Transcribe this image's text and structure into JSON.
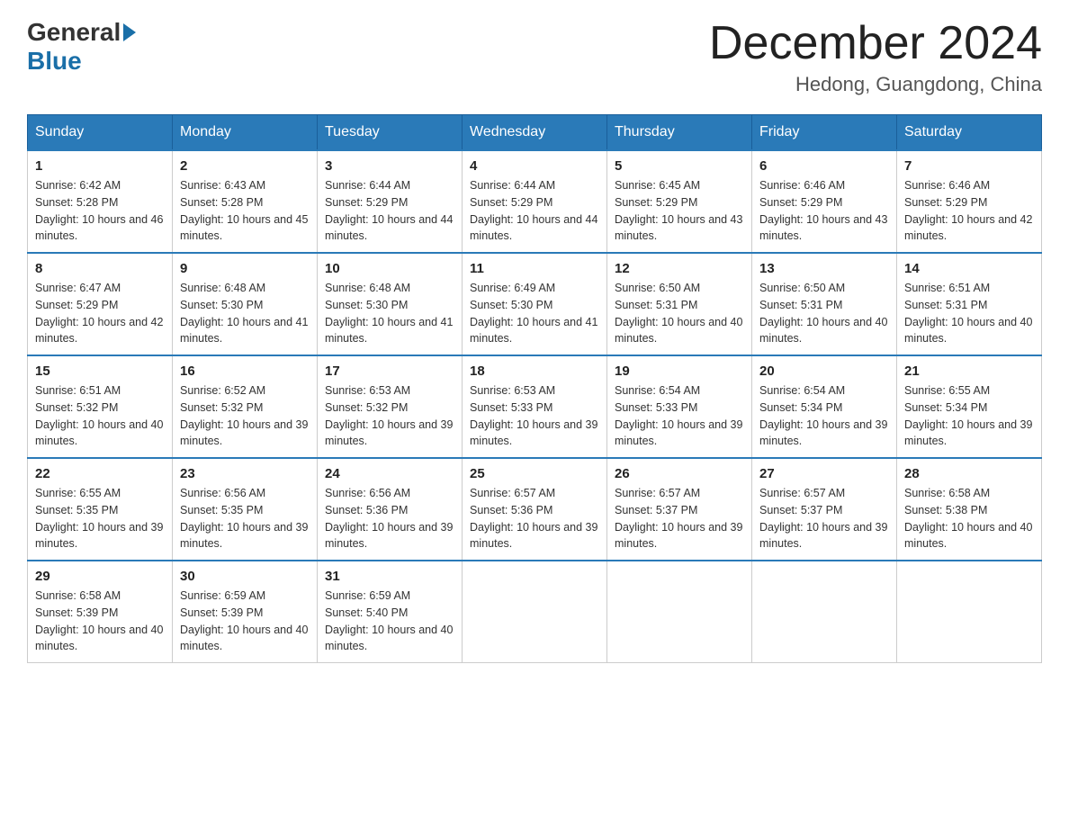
{
  "logo": {
    "general": "General",
    "blue": "Blue"
  },
  "title": "December 2024",
  "location": "Hedong, Guangdong, China",
  "days_of_week": [
    "Sunday",
    "Monday",
    "Tuesday",
    "Wednesday",
    "Thursday",
    "Friday",
    "Saturday"
  ],
  "weeks": [
    [
      {
        "day": "1",
        "sunrise": "6:42 AM",
        "sunset": "5:28 PM",
        "daylight": "10 hours and 46 minutes."
      },
      {
        "day": "2",
        "sunrise": "6:43 AM",
        "sunset": "5:28 PM",
        "daylight": "10 hours and 45 minutes."
      },
      {
        "day": "3",
        "sunrise": "6:44 AM",
        "sunset": "5:29 PM",
        "daylight": "10 hours and 44 minutes."
      },
      {
        "day": "4",
        "sunrise": "6:44 AM",
        "sunset": "5:29 PM",
        "daylight": "10 hours and 44 minutes."
      },
      {
        "day": "5",
        "sunrise": "6:45 AM",
        "sunset": "5:29 PM",
        "daylight": "10 hours and 43 minutes."
      },
      {
        "day": "6",
        "sunrise": "6:46 AM",
        "sunset": "5:29 PM",
        "daylight": "10 hours and 43 minutes."
      },
      {
        "day": "7",
        "sunrise": "6:46 AM",
        "sunset": "5:29 PM",
        "daylight": "10 hours and 42 minutes."
      }
    ],
    [
      {
        "day": "8",
        "sunrise": "6:47 AM",
        "sunset": "5:29 PM",
        "daylight": "10 hours and 42 minutes."
      },
      {
        "day": "9",
        "sunrise": "6:48 AM",
        "sunset": "5:30 PM",
        "daylight": "10 hours and 41 minutes."
      },
      {
        "day": "10",
        "sunrise": "6:48 AM",
        "sunset": "5:30 PM",
        "daylight": "10 hours and 41 minutes."
      },
      {
        "day": "11",
        "sunrise": "6:49 AM",
        "sunset": "5:30 PM",
        "daylight": "10 hours and 41 minutes."
      },
      {
        "day": "12",
        "sunrise": "6:50 AM",
        "sunset": "5:31 PM",
        "daylight": "10 hours and 40 minutes."
      },
      {
        "day": "13",
        "sunrise": "6:50 AM",
        "sunset": "5:31 PM",
        "daylight": "10 hours and 40 minutes."
      },
      {
        "day": "14",
        "sunrise": "6:51 AM",
        "sunset": "5:31 PM",
        "daylight": "10 hours and 40 minutes."
      }
    ],
    [
      {
        "day": "15",
        "sunrise": "6:51 AM",
        "sunset": "5:32 PM",
        "daylight": "10 hours and 40 minutes."
      },
      {
        "day": "16",
        "sunrise": "6:52 AM",
        "sunset": "5:32 PM",
        "daylight": "10 hours and 39 minutes."
      },
      {
        "day": "17",
        "sunrise": "6:53 AM",
        "sunset": "5:32 PM",
        "daylight": "10 hours and 39 minutes."
      },
      {
        "day": "18",
        "sunrise": "6:53 AM",
        "sunset": "5:33 PM",
        "daylight": "10 hours and 39 minutes."
      },
      {
        "day": "19",
        "sunrise": "6:54 AM",
        "sunset": "5:33 PM",
        "daylight": "10 hours and 39 minutes."
      },
      {
        "day": "20",
        "sunrise": "6:54 AM",
        "sunset": "5:34 PM",
        "daylight": "10 hours and 39 minutes."
      },
      {
        "day": "21",
        "sunrise": "6:55 AM",
        "sunset": "5:34 PM",
        "daylight": "10 hours and 39 minutes."
      }
    ],
    [
      {
        "day": "22",
        "sunrise": "6:55 AM",
        "sunset": "5:35 PM",
        "daylight": "10 hours and 39 minutes."
      },
      {
        "day": "23",
        "sunrise": "6:56 AM",
        "sunset": "5:35 PM",
        "daylight": "10 hours and 39 minutes."
      },
      {
        "day": "24",
        "sunrise": "6:56 AM",
        "sunset": "5:36 PM",
        "daylight": "10 hours and 39 minutes."
      },
      {
        "day": "25",
        "sunrise": "6:57 AM",
        "sunset": "5:36 PM",
        "daylight": "10 hours and 39 minutes."
      },
      {
        "day": "26",
        "sunrise": "6:57 AM",
        "sunset": "5:37 PM",
        "daylight": "10 hours and 39 minutes."
      },
      {
        "day": "27",
        "sunrise": "6:57 AM",
        "sunset": "5:37 PM",
        "daylight": "10 hours and 39 minutes."
      },
      {
        "day": "28",
        "sunrise": "6:58 AM",
        "sunset": "5:38 PM",
        "daylight": "10 hours and 40 minutes."
      }
    ],
    [
      {
        "day": "29",
        "sunrise": "6:58 AM",
        "sunset": "5:39 PM",
        "daylight": "10 hours and 40 minutes."
      },
      {
        "day": "30",
        "sunrise": "6:59 AM",
        "sunset": "5:39 PM",
        "daylight": "10 hours and 40 minutes."
      },
      {
        "day": "31",
        "sunrise": "6:59 AM",
        "sunset": "5:40 PM",
        "daylight": "10 hours and 40 minutes."
      },
      null,
      null,
      null,
      null
    ]
  ]
}
